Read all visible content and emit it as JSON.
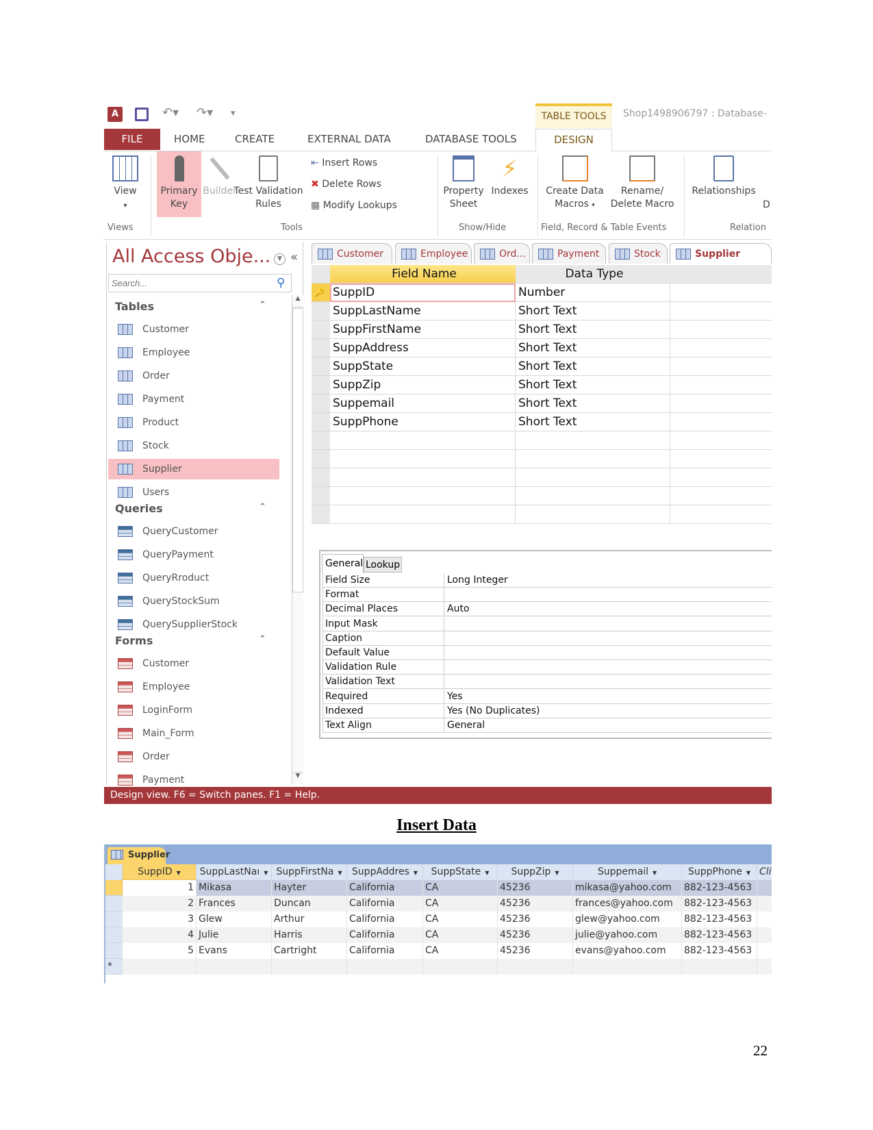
{
  "window": {
    "title": "Shop1498906797 : Database- ",
    "contextual_tab": "TABLE TOOLS",
    "accent": "#a4373a"
  },
  "ribbon_tabs": [
    "FILE",
    "HOME",
    "CREATE",
    "EXTERNAL DATA",
    "DATABASE TOOLS",
    "DESIGN"
  ],
  "ribbon": {
    "view": "View",
    "primary_key": [
      "Primary",
      "Key"
    ],
    "builder": "Builder",
    "test_validation": [
      "Test Validation",
      "Rules"
    ],
    "insert_rows": "Insert Rows",
    "delete_rows": "Delete Rows",
    "modify_lookups": "Modify Lookups",
    "property_sheet": [
      "Property",
      "Sheet"
    ],
    "indexes": "Indexes",
    "create_data_macros": [
      "Create Data",
      "Macros"
    ],
    "rename_delete_macro": [
      "Rename/",
      "Delete Macro"
    ],
    "relationships": "Relationships",
    "d_cut": "D",
    "groups": [
      "Views",
      "Tools",
      "Show/Hide",
      "Field, Record & Table Events",
      "Relation"
    ]
  },
  "nav": {
    "title": "All Access Obje...",
    "search_placeholder": "Search...",
    "groups": [
      {
        "label": "Tables",
        "items": [
          "Customer",
          "Employee",
          "Order",
          "Payment",
          "Product",
          "Stock",
          "Supplier",
          "Users"
        ]
      },
      {
        "label": "Queries",
        "items": [
          "QueryCustomer",
          "QueryPayment",
          "QueryRroduct",
          "QueryStockSum",
          "QuerySupplierStock"
        ]
      },
      {
        "label": "Forms",
        "items": [
          "Customer",
          "Employee",
          "LoginForm",
          "Main_Form",
          "Order",
          "Payment"
        ]
      }
    ],
    "selected": "Supplier"
  },
  "doc_tabs": [
    "Customer",
    "Employee",
    "Ord...",
    "Payment",
    "Stock",
    "Supplier"
  ],
  "design_grid": {
    "headers": [
      "Field Name",
      "Data Type"
    ],
    "rows": [
      [
        "SuppID",
        "Number"
      ],
      [
        "SuppLastName",
        "Short Text"
      ],
      [
        "SuppFirstName",
        "Short Text"
      ],
      [
        "SuppAddress",
        "Short Text"
      ],
      [
        "SuppState",
        "Short Text"
      ],
      [
        "SuppZip",
        "Short Text"
      ],
      [
        "Suppemail",
        "Short Text"
      ],
      [
        "SuppPhone",
        "Short Text"
      ]
    ]
  },
  "properties": {
    "tabs": [
      "General",
      "Lookup"
    ],
    "rows": [
      [
        "Field Size",
        "Long Integer"
      ],
      [
        "Format",
        ""
      ],
      [
        "Decimal Places",
        "Auto"
      ],
      [
        "Input Mask",
        ""
      ],
      [
        "Caption",
        ""
      ],
      [
        "Default Value",
        ""
      ],
      [
        "Validation Rule",
        ""
      ],
      [
        "Validation Text",
        ""
      ],
      [
        "Required",
        "Yes"
      ],
      [
        "Indexed",
        "Yes (No Duplicates)"
      ],
      [
        "Text Align",
        "General"
      ]
    ]
  },
  "status": "Design view.  F6 = Switch panes.  F1 = Help.",
  "heading": "Insert Data",
  "datasheet": {
    "tab": "Supplier",
    "headers": [
      "SuppID",
      "SuppLastNaı",
      "SuppFirstNa",
      "SuppAddres",
      "SuppState",
      "SuppZip",
      "Suppemail",
      "SuppPhone",
      "Cli"
    ],
    "rows": [
      [
        "1",
        "Mikasa",
        "Hayter",
        "California",
        "CA",
        "45236",
        "mikasa@yahoo.com",
        "882-123-4563"
      ],
      [
        "2",
        "Frances",
        "Duncan",
        "California",
        "CA",
        "45236",
        "frances@yahoo.com",
        "882-123-4563"
      ],
      [
        "3",
        "Glew",
        "Arthur",
        "California",
        "CA",
        "45236",
        "glew@yahoo.com",
        "882-123-4563"
      ],
      [
        "4",
        "Julie",
        "Harris",
        "California",
        "CA",
        "45236",
        "julie@yahoo.com",
        "882-123-4563"
      ],
      [
        "5",
        "Evans",
        "Cartright",
        "California",
        "CA",
        "45236",
        "evans@yahoo.com",
        "882-123-4563"
      ]
    ],
    "new_row_marker": "*"
  },
  "page_number": "22"
}
